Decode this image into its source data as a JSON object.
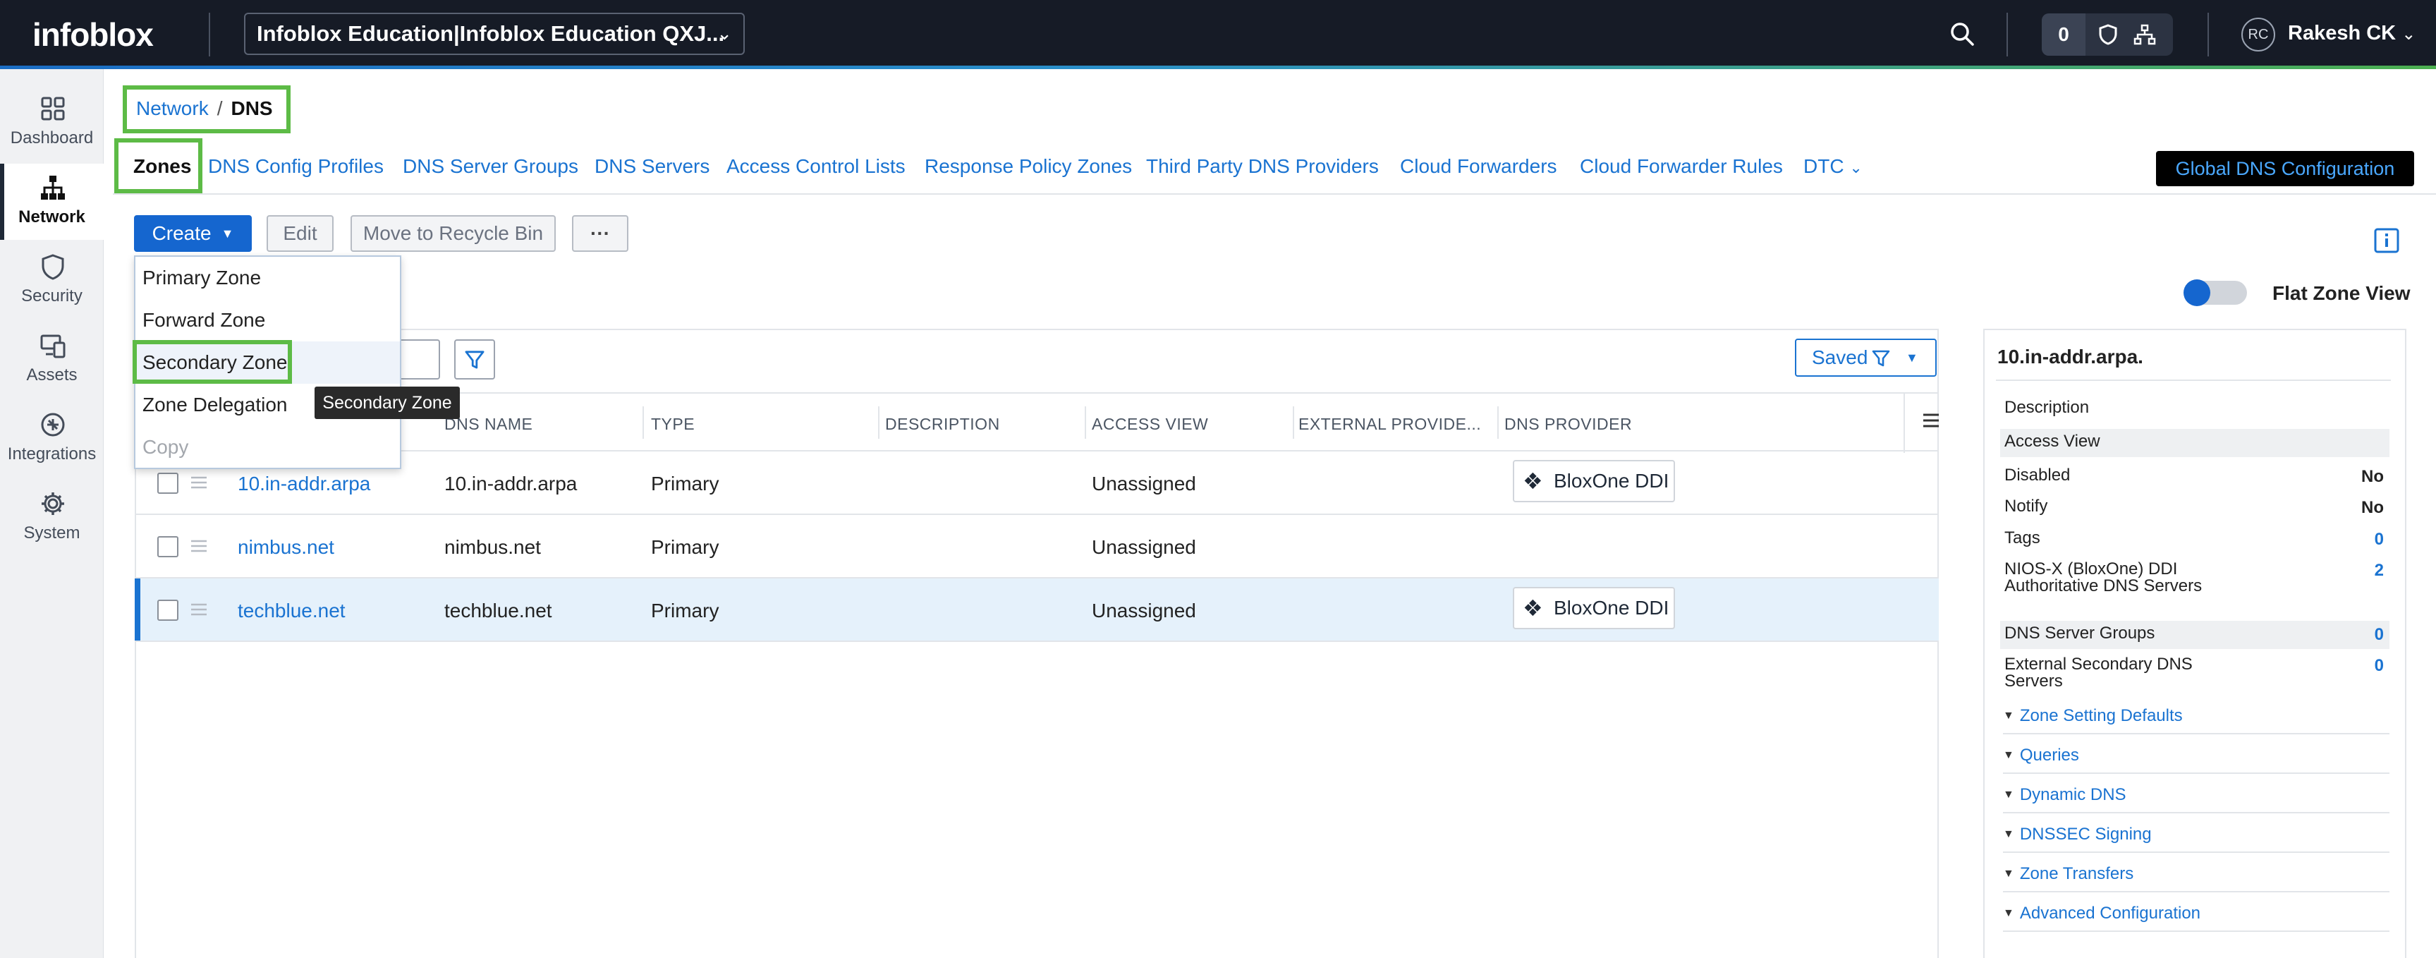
{
  "header": {
    "logo": "infoblox",
    "account": "Infoblox Education|Infoblox Education QXJ...",
    "counter": "0",
    "user_initials": "RC",
    "user_name": "Rakesh CK"
  },
  "sidebar": {
    "items": [
      {
        "label": "Dashboard",
        "icon": "dashboard-icon"
      },
      {
        "label": "Network",
        "icon": "network-icon",
        "active": true
      },
      {
        "label": "Security",
        "icon": "shield-icon"
      },
      {
        "label": "Assets",
        "icon": "assets-icon"
      },
      {
        "label": "Integrations",
        "icon": "integrations-icon"
      },
      {
        "label": "System",
        "icon": "gear-icon"
      }
    ]
  },
  "breadcrumb": {
    "parent": "Network",
    "separator": "/",
    "current": "DNS"
  },
  "tabs": [
    "Zones",
    "DNS Config Profiles",
    "DNS Server Groups",
    "DNS Servers",
    "Access Control Lists",
    "Response Policy Zones",
    "Third Party DNS Providers",
    "Cloud Forwarders",
    "Cloud Forwarder Rules",
    "DTC"
  ],
  "global_dns_button": "Global DNS Configuration",
  "toolbar": {
    "create": "Create",
    "edit": "Edit",
    "recycle": "Move to Recycle Bin",
    "more": "···"
  },
  "create_menu": {
    "items": [
      "Primary Zone",
      "Forward Zone",
      "Secondary Zone",
      "Zone Delegation",
      "Copy"
    ]
  },
  "tooltip": "Secondary Zone",
  "flat_zone_view": {
    "label": "Flat Zone View",
    "enabled": true
  },
  "saved_filter": "Saved",
  "table": {
    "columns": [
      "DNS NAME",
      "TYPE",
      "DESCRIPTION",
      "ACCESS VIEW",
      "EXTERNAL PROVIDE...",
      "DNS PROVIDER"
    ],
    "rows": [
      {
        "name": "10.in-addr.arpa",
        "dns_name": "10.in-addr.arpa",
        "type": "Primary",
        "description": "",
        "access_view": "Unassigned",
        "external": "",
        "provider": "BloxOne DDI"
      },
      {
        "name": "nimbus.net",
        "dns_name": "nimbus.net",
        "type": "Primary",
        "description": "",
        "access_view": "Unassigned",
        "external": "",
        "provider": ""
      },
      {
        "name": "techblue.net",
        "dns_name": "techblue.net",
        "type": "Primary",
        "description": "",
        "access_view": "Unassigned",
        "external": "",
        "provider": "BloxOne DDI",
        "selected": true
      }
    ]
  },
  "details": {
    "title": "10.in-addr.arpa.",
    "properties": [
      {
        "label": "Description",
        "value": ""
      },
      {
        "label": "Access View",
        "value": ""
      },
      {
        "label": "Disabled",
        "value": "No"
      },
      {
        "label": "Notify",
        "value": "No"
      },
      {
        "label": "Tags",
        "value": "0"
      },
      {
        "label": "NIOS-X (BloxOne) DDI Authoritative DNS Servers",
        "value": "2"
      },
      {
        "label": "DNS Server Groups",
        "value": "0"
      },
      {
        "label": "External Secondary DNS Servers",
        "value": "0"
      }
    ],
    "sections": [
      "Zone Setting Defaults",
      "Queries",
      "Dynamic DNS",
      "DNSSEC Signing",
      "Zone Transfers",
      "Advanced Configuration"
    ]
  },
  "colors": {
    "accent": "#1566cf",
    "link": "#1a73d1",
    "highlight": "#5dbb46",
    "topbar": "#161b26"
  }
}
